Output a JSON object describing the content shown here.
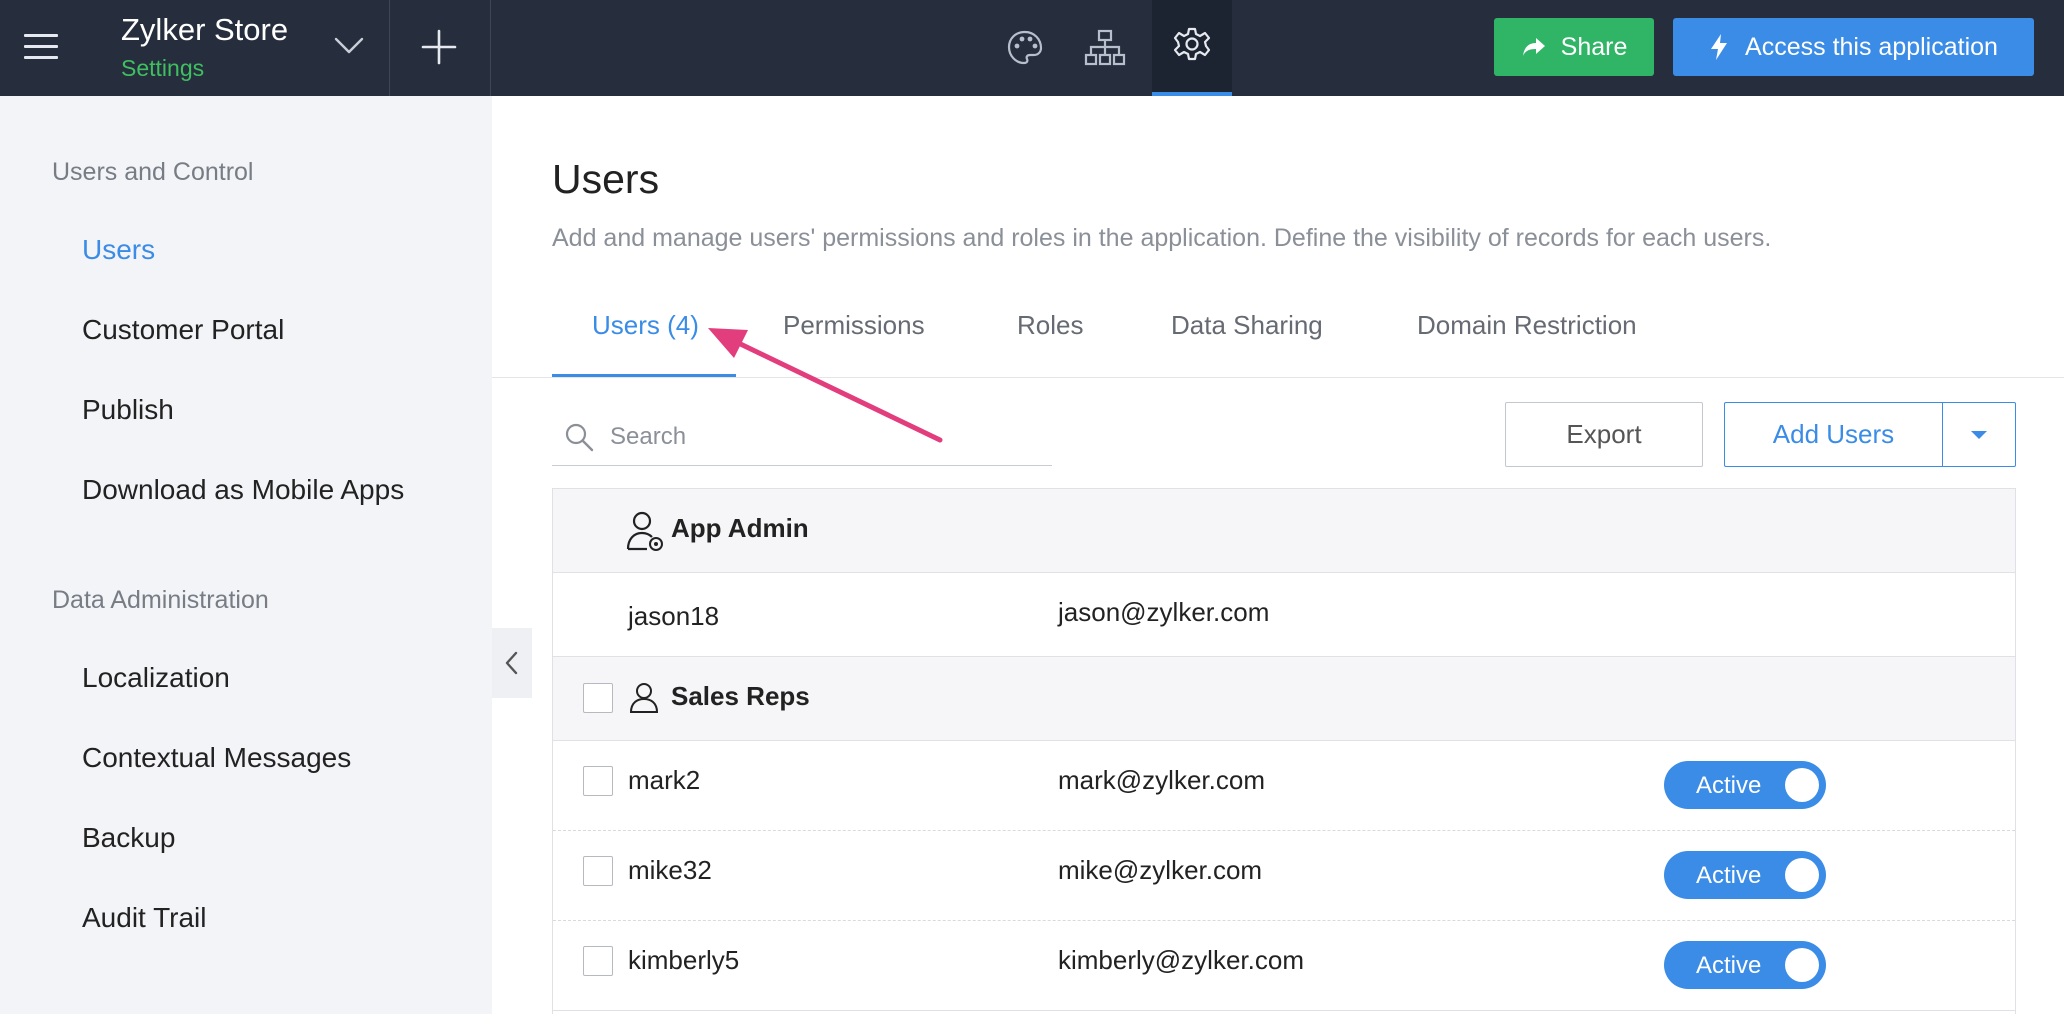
{
  "header": {
    "app_name": "Zylker Store",
    "app_subtitle": "Settings",
    "nav_icons": [
      "palette-icon",
      "sitemap-icon",
      "gear-icon"
    ],
    "active_nav": "gear-icon",
    "share_label": "Share",
    "access_label": "Access this application"
  },
  "sidebar": {
    "sections": [
      {
        "title": "Users and Control",
        "items": [
          {
            "label": "Users",
            "active": true
          },
          {
            "label": "Customer Portal"
          },
          {
            "label": "Publish"
          },
          {
            "label": "Download as Mobile Apps"
          }
        ]
      },
      {
        "title": "Data Administration",
        "items": [
          {
            "label": "Localization"
          },
          {
            "label": "Contextual Messages"
          },
          {
            "label": "Backup"
          },
          {
            "label": "Audit Trail"
          }
        ]
      }
    ]
  },
  "main": {
    "title": "Users",
    "description": "Add and manage users' permissions and roles in the application. Define the visibility of records for each users.",
    "tabs": [
      {
        "label": "Users (4)",
        "active": true
      },
      {
        "label": "Permissions"
      },
      {
        "label": "Roles"
      },
      {
        "label": "Data Sharing"
      },
      {
        "label": "Domain Restriction"
      }
    ],
    "search_placeholder": "Search",
    "export_label": "Export",
    "add_users_label": "Add Users",
    "groups": [
      {
        "name": "App Admin",
        "users": [
          {
            "username": "jason18",
            "email": "jason@zylker.com"
          }
        ]
      },
      {
        "name": "Sales Reps",
        "users": [
          {
            "username": "mark2",
            "email": "mark@zylker.com",
            "status": "Active"
          },
          {
            "username": "mike32",
            "email": "mike@zylker.com",
            "status": "Active"
          },
          {
            "username": "kimberly5",
            "email": "kimberly@zylker.com",
            "status": "Active"
          }
        ]
      }
    ]
  },
  "colors": {
    "topbar": "#262e3d",
    "accent": "#3a8ce6",
    "share_green": "#2fb565",
    "annotation_pink": "#e23d7c"
  }
}
